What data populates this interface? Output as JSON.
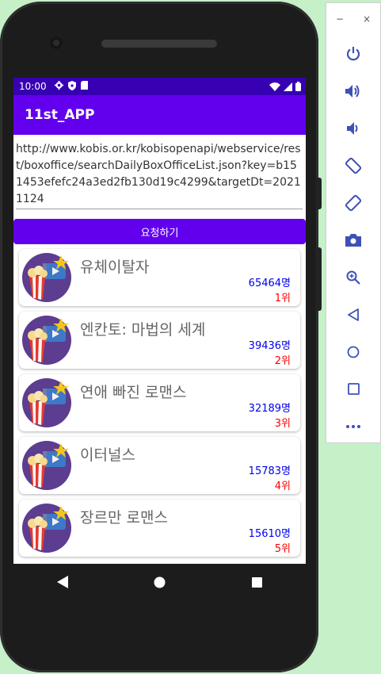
{
  "status_bar": {
    "time": "10:00"
  },
  "app_bar": {
    "title": "11st_APP"
  },
  "url_input": {
    "value": "http://www.kobis.or.kr/kobisopenapi/webservice/rest/boxoffice/searchDailyBoxOfficeList.json?key=b151453efefc24a3ed2fb130d19c4299&targetDt=20211124"
  },
  "request_button": {
    "label": "요청하기"
  },
  "movies": [
    {
      "title": "유체이탈자",
      "audience": "65464명",
      "rank": "1위"
    },
    {
      "title": "엔칸토: 마법의 세계",
      "audience": "39436명",
      "rank": "2위"
    },
    {
      "title": "연애 빠진 로맨스",
      "audience": "32189명",
      "rank": "3위"
    },
    {
      "title": "이터널스",
      "audience": "15783명",
      "rank": "4위"
    },
    {
      "title": "장르만 로맨스",
      "audience": "15610명",
      "rank": "5위"
    }
  ],
  "emulator_panel": {
    "minimize": "−",
    "close": "×",
    "buttons": [
      "power-icon",
      "volume-up-icon",
      "volume-down-icon",
      "rotate-left-icon",
      "rotate-right-icon",
      "camera-icon",
      "zoom-icon",
      "back-icon",
      "home-icon",
      "overview-icon",
      "more-icon"
    ]
  },
  "colors": {
    "primary": "#6200ee",
    "primary_dark": "#3700b3",
    "audience": "#0000ee",
    "rank": "#ff0000",
    "background": "#c5f0c8"
  }
}
